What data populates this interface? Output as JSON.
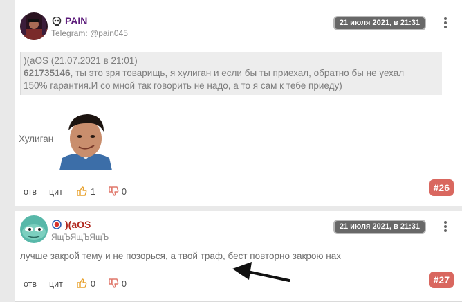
{
  "posts": [
    {
      "username": "PAIN",
      "username_color": "#5b1a7a",
      "subtitle": "Telegram: @pain045",
      "date": "21 июля 2021, в 21:31",
      "quote": {
        "header": ")(aOS (21.07.2021 в 21:01)",
        "mention": "621735146",
        "text_line1": ", ты это зря товарищь, я хулиган и если бы ты приехал, обратно бы не уехал",
        "text_line2": "150% гарантия.И со мной так говорить не надо, а то я сам к тебе приеду)"
      },
      "body_caption": "Хулиган",
      "actions": {
        "reply": "отв",
        "quote": "цит",
        "likes": "1",
        "dislikes": "0"
      },
      "post_number": "#26",
      "icons": {
        "rank": "skull-icon",
        "like": "thumbs-up-icon",
        "dislike": "thumbs-down-icon",
        "menu": "more-vertical-icon"
      }
    },
    {
      "username": ")(aOS",
      "username_color": "#b0281e",
      "subtitle": "ЯщЪЯщЪЯщЪ",
      "date": "21 июля 2021, в 21:31",
      "body_text": "лучше закрой тему и не позорься, а твой траф, бест повторно закрою нах",
      "actions": {
        "reply": "отв",
        "quote": "цит",
        "likes": "0",
        "dislikes": "0"
      },
      "post_number": "#27",
      "icons": {
        "rank": "target-icon",
        "like": "thumbs-up-icon",
        "dislike": "thumbs-down-icon",
        "menu": "more-vertical-icon"
      }
    }
  ],
  "colors": {
    "accent_like": "#e8a22f",
    "accent_dislike": "#e0786c",
    "post_number_bg": "#d9675f",
    "date_pill_bg": "#686868"
  }
}
